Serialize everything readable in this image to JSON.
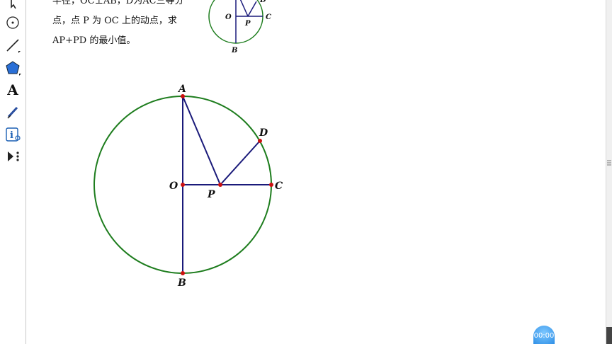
{
  "problem": {
    "line1": "半径，OC⊥AB，D为AC三等分",
    "line2": "点，点 P 为 OC 上的动点，求",
    "line3": "AP+PD 的最小值。"
  },
  "figure": {
    "labels": {
      "A": "A",
      "B": "B",
      "C": "C",
      "D": "D",
      "O": "O",
      "P": "P"
    },
    "circle_color": "#1e7d1e",
    "line_color": "#1a1a7a",
    "point_color": "#cc1111"
  },
  "toolbar": {
    "tools": [
      "arrow-tool",
      "point-tool",
      "compass-tool",
      "line-tool",
      "polygon-tool",
      "text-tool",
      "marker-tool",
      "info-tool",
      "custom-tool"
    ],
    "text_tool_label": "A"
  },
  "timer": {
    "value": "00:00"
  }
}
